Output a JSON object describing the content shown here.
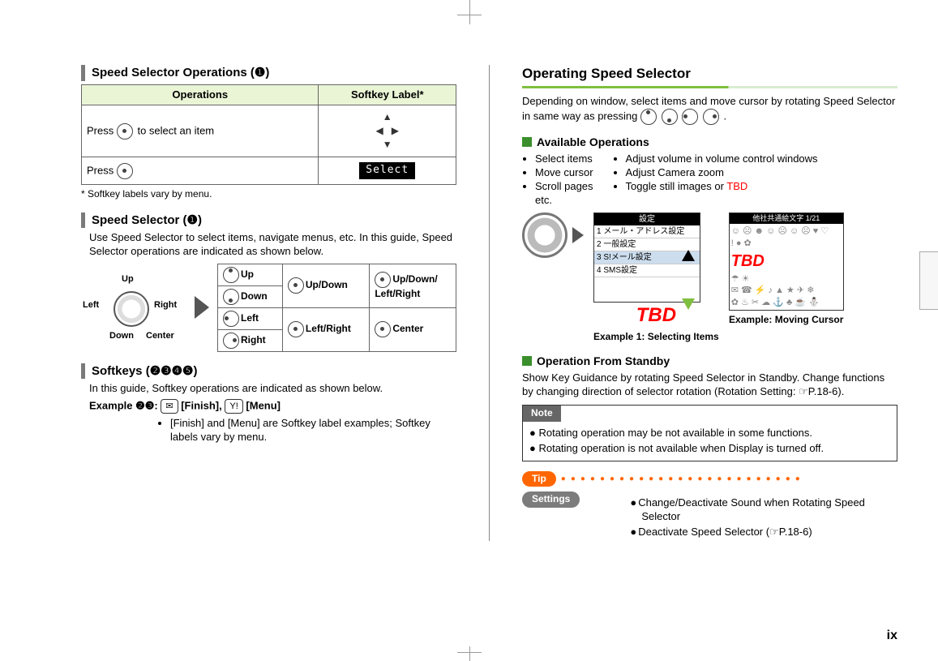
{
  "page_number": "ix",
  "left": {
    "h1": "Speed Selector Operations (❶)",
    "table": {
      "head_ops": "Operations",
      "head_label": "Softkey Label*",
      "row1_ops_pre": "Press ",
      "row1_ops_post": " to select an item",
      "row2_ops": "Press ",
      "row2_label": "Select"
    },
    "footnote": "* Softkey labels vary by menu.",
    "h2": "Speed Selector (❶)",
    "h2_desc": "Use Speed Selector to select items, navigate menus, etc. In this guide, Speed Selector operations are indicated as shown below.",
    "diag": {
      "up": "Up",
      "left": "Left",
      "right": "Right",
      "down": "Down",
      "center": "Center"
    },
    "legend": {
      "up": "Up",
      "down": "Down",
      "left": "Left",
      "right": "Right",
      "updown": "Up/Down",
      "leftright": "Left/Right",
      "updownleftright": "Up/Down/\nLeft/Right",
      "center": "Center"
    },
    "h3": "Softkeys (❷❸❹❺)",
    "h3_desc": "In this guide, Softkey operations are indicated as shown below.",
    "example_label": "Example ❷❸:",
    "example_finish_btn": "✉",
    "example_finish_txt": "[Finish],",
    "example_menu_btn": "Y!",
    "example_menu_txt": "[Menu]",
    "example_b1": "[Finish] and [Menu] are Softkey label examples; Softkey labels vary by menu."
  },
  "right": {
    "h1": "Operating Speed Selector",
    "intro": "Depending on window, select items and move cursor by rotating Speed Selector in same way as pressing ",
    "intro_post": ".",
    "sub1": "Available Operations",
    "colA": [
      "Select items",
      "Move cursor",
      "Scroll pages"
    ],
    "colA_etc": "etc.",
    "colB": [
      "Adjust volume in volume control windows",
      "Adjust Camera zoom"
    ],
    "colB_last_pre": "Toggle still images or ",
    "colB_last_tbd": "TBD",
    "screen1": {
      "title": "設定",
      "rows": [
        "1 メール・アドレス設定",
        "2 一般設定",
        "3 S!メール設定",
        "4 SMS設定"
      ]
    },
    "tbd_big": "TBD",
    "cap1": "Example 1: Selecting Items",
    "cap2": "Example: Moving Cursor",
    "screen2_title": "他社共通絵文字       1/21",
    "sub2": "Operation From Standby",
    "sub2_desc": "Show Key Guidance by rotating Speed Selector in Standby. Change functions by changing direction of selector rotation (Rotation Setting: ☞P.18-6).",
    "note_hdr": "Note",
    "note1": "Rotating operation may be not available in some functions.",
    "note2": "Rotating operation is not available when Display is turned off.",
    "tip": "Tip",
    "settings": "Settings",
    "set1": "Change/Deactivate Sound when Rotating Speed Selector",
    "set2": "Deactivate Speed Selector (☞P.18-6)"
  }
}
